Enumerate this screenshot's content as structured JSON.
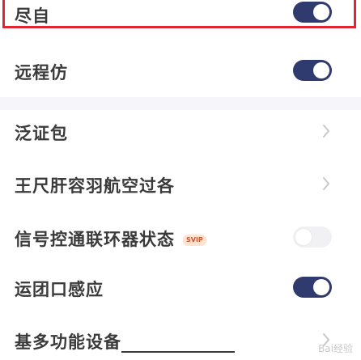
{
  "settings": {
    "rows": [
      {
        "label": "尽自",
        "control": "toggle",
        "state": "on"
      },
      {
        "label": "远程仿",
        "control": "toggle",
        "state": "on"
      },
      {
        "label": "泛证包",
        "control": "chevron"
      },
      {
        "label": "王尺肝容羽航空过各",
        "control": "chevron"
      },
      {
        "label": "信号控通联环器状态",
        "control": "toggle",
        "state": "off",
        "badge": "SVIP"
      },
      {
        "label": "运团口感应",
        "control": "toggle",
        "state": "on"
      },
      {
        "label": "基多功能设备",
        "control": "chevron"
      }
    ]
  },
  "watermark": "Bai经验",
  "colors": {
    "highlight_border": "#e02530",
    "toggle_on": "#2f3a6e",
    "toggle_off": "#f1f1f4",
    "badge_bg": "#ffe3d0",
    "badge_text": "#d4542a"
  }
}
